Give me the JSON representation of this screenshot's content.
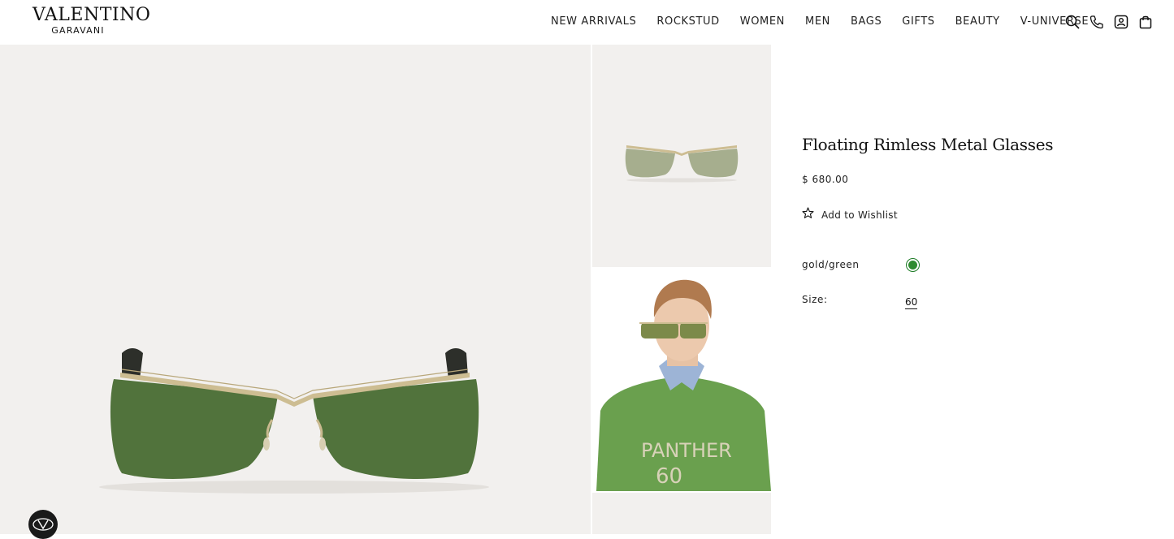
{
  "brand": {
    "name": "VALENTINO",
    "sub": "GARAVANI"
  },
  "nav": {
    "items": [
      {
        "label": "NEW ARRIVALS"
      },
      {
        "label": "ROCKSTUD"
      },
      {
        "label": "WOMEN"
      },
      {
        "label": "MEN"
      },
      {
        "label": "BAGS"
      },
      {
        "label": "GIFTS"
      },
      {
        "label": "BEAUTY"
      },
      {
        "label": "V-UNIVERSE"
      }
    ]
  },
  "header_icons": [
    "search-icon",
    "phone-icon",
    "account-icon",
    "bag-icon"
  ],
  "product": {
    "title": "Floating Rimless Metal Glasses",
    "price": "$ 680.00",
    "wishlist_label": "Add to Wishlist",
    "color_label": "gold/green",
    "color_swatch": "#2e8b2f",
    "size_label": "Size:",
    "size_value": "60"
  },
  "images": {
    "thumb2_shirt_text_line1": "PANTHER",
    "thumb2_shirt_text_line2": "60"
  },
  "colors": {
    "lens": "#4f7a3a",
    "frame": "#c9b98f",
    "background": "#f2f0ee",
    "sweater": "#6aa04e"
  }
}
